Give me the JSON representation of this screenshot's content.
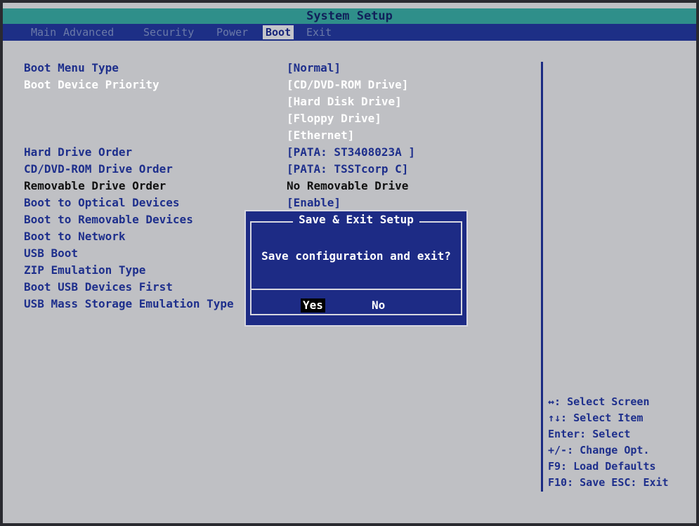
{
  "title": "System Setup",
  "tabs": [
    "Main",
    "Advanced",
    "Security",
    "Power",
    "Boot",
    "Exit"
  ],
  "active_tab": "Boot",
  "settings": [
    {
      "label": "Boot Menu Type",
      "value": "[Normal]"
    },
    {
      "label": "Boot Device Priority",
      "values": [
        "[CD/DVD-ROM Drive]",
        "[Hard Disk Drive]",
        "[Floppy Drive]",
        "[Ethernet]"
      ]
    },
    {
      "label": "Hard Drive Order",
      "value": "[PATA: ST3408023A ]"
    },
    {
      "label": "CD/DVD-ROM Drive Order",
      "value": "[PATA: TSSTcorp C]"
    },
    {
      "label": "Removable Drive Order",
      "value": "No Removable Drive"
    },
    {
      "label": "Boot to Optical Devices",
      "value": "[Enable]"
    },
    {
      "label": "Boot to Removable Devices",
      "value": ""
    },
    {
      "label": "Boot to Network",
      "value": ""
    },
    {
      "label": "USB Boot",
      "value": ""
    },
    {
      "label": "ZIP Emulation Type",
      "value": ""
    },
    {
      "label": "Boot USB Devices First",
      "value": ""
    },
    {
      "label": "USB Mass Storage Emulation Type",
      "value": ""
    }
  ],
  "help": [
    "↔: Select Screen",
    "↑↓: Select Item",
    "Enter: Select",
    "+/-: Change Opt.",
    "F9: Load Defaults",
    "F10: Save  ESC: Exit"
  ],
  "dialog": {
    "title": "Save & Exit Setup",
    "message": "Save configuration and exit?",
    "yes_label": "Yes",
    "no_label": "No",
    "selected": "Yes"
  },
  "colors": {
    "background": "#bfc0c4",
    "title_bar": "#2f8f8a",
    "menu_bar": "#1d2f86",
    "dialog_bg": "#1d2b85",
    "text_blue": "#1e2f8c"
  }
}
